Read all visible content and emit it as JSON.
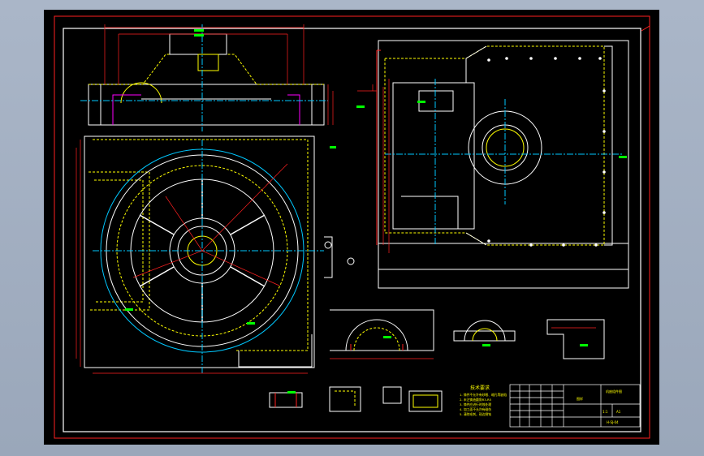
{
  "drawing": {
    "type": "cad-mechanical-drawing",
    "title_block": {
      "drawing_name": "机座组件图",
      "center_label": "图样",
      "scale_label": "1:1",
      "sheet_label": "A1",
      "code_label": "H-SJ-04"
    },
    "tech_notes": {
      "heading": "技术要求",
      "items": [
        "1. 铸件不允许有砂眼、缩孔等缺陷",
        "2. 未注铸造圆角R3-R5",
        "3. 铸件应进行时效处理",
        "4. 加工面不允许有碰伤",
        "5. 清除毛刺，锐边倒钝"
      ]
    },
    "colors": {
      "sheet": "#000000",
      "frame": "#ff2020",
      "outline": "#ffffff",
      "hidden": "#ffff00",
      "center": "#00c8ff",
      "dimension": "#ff2020",
      "dim_text": "#00ff00",
      "hatch": "#ff00ff"
    }
  }
}
